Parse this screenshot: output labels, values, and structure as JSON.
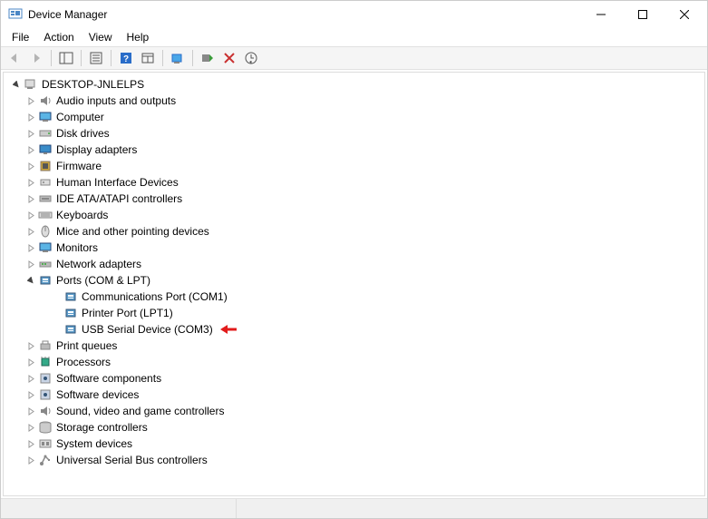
{
  "window": {
    "title": "Device Manager"
  },
  "menu": {
    "items": [
      "File",
      "Action",
      "View",
      "Help"
    ]
  },
  "toolbar": {
    "back": "Back",
    "forward": "Forward",
    "showhide": "Show/Hide Console Tree",
    "properties": "Properties",
    "help": "Help",
    "fullview": "View",
    "scan": "Scan for hardware changes",
    "update": "Update driver",
    "uninstall": "Uninstall",
    "enable": "Enable"
  },
  "tree": {
    "root": "DESKTOP-JNLELPS",
    "categories": [
      {
        "label": "Audio inputs and outputs",
        "icon": "speaker",
        "expanded": false
      },
      {
        "label": "Computer",
        "icon": "monitor",
        "expanded": false
      },
      {
        "label": "Disk drives",
        "icon": "disk",
        "expanded": false
      },
      {
        "label": "Display adapters",
        "icon": "display",
        "expanded": false
      },
      {
        "label": "Firmware",
        "icon": "chip",
        "expanded": false
      },
      {
        "label": "Human Interface Devices",
        "icon": "hid",
        "expanded": false
      },
      {
        "label": "IDE ATA/ATAPI controllers",
        "icon": "ide",
        "expanded": false
      },
      {
        "label": "Keyboards",
        "icon": "keyboard",
        "expanded": false
      },
      {
        "label": "Mice and other pointing devices",
        "icon": "mouse",
        "expanded": false
      },
      {
        "label": "Monitors",
        "icon": "monitor",
        "expanded": false
      },
      {
        "label": "Network adapters",
        "icon": "network",
        "expanded": false
      },
      {
        "label": "Ports (COM & LPT)",
        "icon": "port",
        "expanded": true,
        "children": [
          {
            "label": "Communications Port (COM1)",
            "icon": "port"
          },
          {
            "label": "Printer Port (LPT1)",
            "icon": "port"
          },
          {
            "label": "USB Serial Device (COM3)",
            "icon": "port",
            "highlighted": true
          }
        ]
      },
      {
        "label": "Print queues",
        "icon": "printer",
        "expanded": false
      },
      {
        "label": "Processors",
        "icon": "cpu",
        "expanded": false
      },
      {
        "label": "Software components",
        "icon": "software",
        "expanded": false
      },
      {
        "label": "Software devices",
        "icon": "software",
        "expanded": false
      },
      {
        "label": "Sound, video and game controllers",
        "icon": "speaker",
        "expanded": false
      },
      {
        "label": "Storage controllers",
        "icon": "storage",
        "expanded": false
      },
      {
        "label": "System devices",
        "icon": "system",
        "expanded": false
      },
      {
        "label": "Universal Serial Bus controllers",
        "icon": "usb",
        "expanded": false
      }
    ]
  }
}
